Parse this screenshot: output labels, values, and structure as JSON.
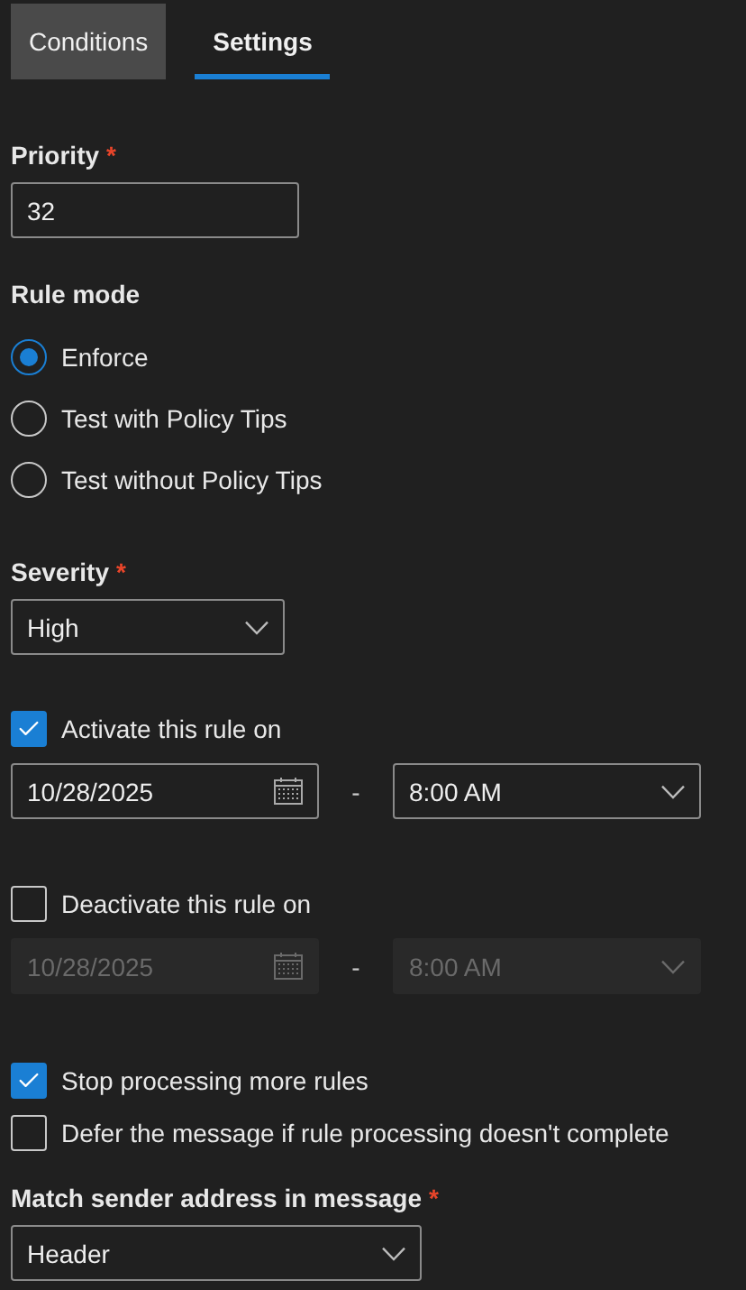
{
  "tabs": [
    {
      "label": "Conditions",
      "selected": false
    },
    {
      "label": "Settings",
      "selected": true
    }
  ],
  "priority": {
    "label": "Priority",
    "required_mark": "*",
    "value": "32"
  },
  "rule_mode": {
    "label": "Rule mode",
    "options": [
      {
        "label": "Enforce",
        "selected": true
      },
      {
        "label": "Test with Policy Tips",
        "selected": false
      },
      {
        "label": "Test without Policy Tips",
        "selected": false
      }
    ]
  },
  "severity": {
    "label": "Severity",
    "required_mark": "*",
    "value": "High"
  },
  "schedules": [
    {
      "label": "Activate this rule on",
      "checked": true,
      "disabled": false,
      "date": "10/28/2025",
      "separator": "-",
      "time": "8:00 AM"
    },
    {
      "label": "Deactivate this rule on",
      "checked": false,
      "disabled": true,
      "date": "10/28/2025",
      "separator": "-",
      "time": "8:00 AM"
    }
  ],
  "options": [
    {
      "label": "Stop processing more rules",
      "checked": true
    },
    {
      "label": "Defer the message if rule processing doesn't complete",
      "checked": false
    }
  ],
  "match_sender": {
    "label": "Match sender address in message",
    "required_mark": "*",
    "value": "Header"
  }
}
